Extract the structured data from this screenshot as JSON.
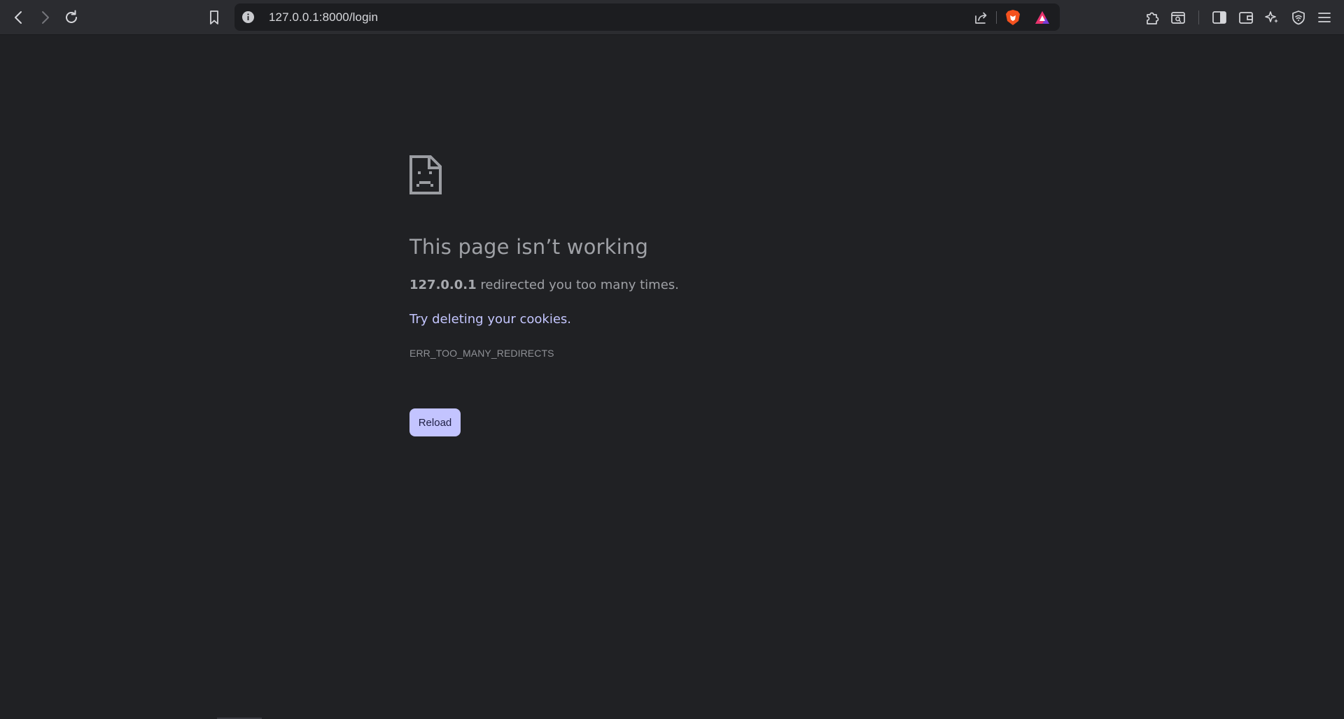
{
  "browser": {
    "url": "127.0.0.1:8000/login",
    "icons": {
      "back": "arrow-left-icon",
      "forward": "arrow-right-icon",
      "reload": "reload-icon",
      "bookmark": "bookmark-icon",
      "site_info": "info-icon",
      "share": "share-icon",
      "brave_shields": "brave-lion-icon",
      "brave_rewards": "triangle-rewards-icon",
      "extensions": "puzzle-icon",
      "search_tab": "search-window-icon",
      "sidebar": "sidebar-icon",
      "wallet": "wallet-icon",
      "leo_ai": "sparkle-icon",
      "vpn": "shield-icon",
      "menu": "hamburger-icon"
    },
    "colors": {
      "toolbar_bg": "#2b2c30",
      "omnibox_bg": "#1c1d20",
      "page_bg": "#202124"
    }
  },
  "error_page": {
    "icon": "sad-page-icon",
    "title": "This page isn’t working",
    "host": "127.0.0.1",
    "description": " redirected you too many times.",
    "suggestion": "Try deleting your cookies.",
    "error_code": "ERR_TOO_MANY_REDIRECTS",
    "reload_label": "Reload",
    "colors": {
      "title": "#9fa1a6",
      "link": "#c4c6ff",
      "button_bg": "#c3c4ff"
    }
  }
}
